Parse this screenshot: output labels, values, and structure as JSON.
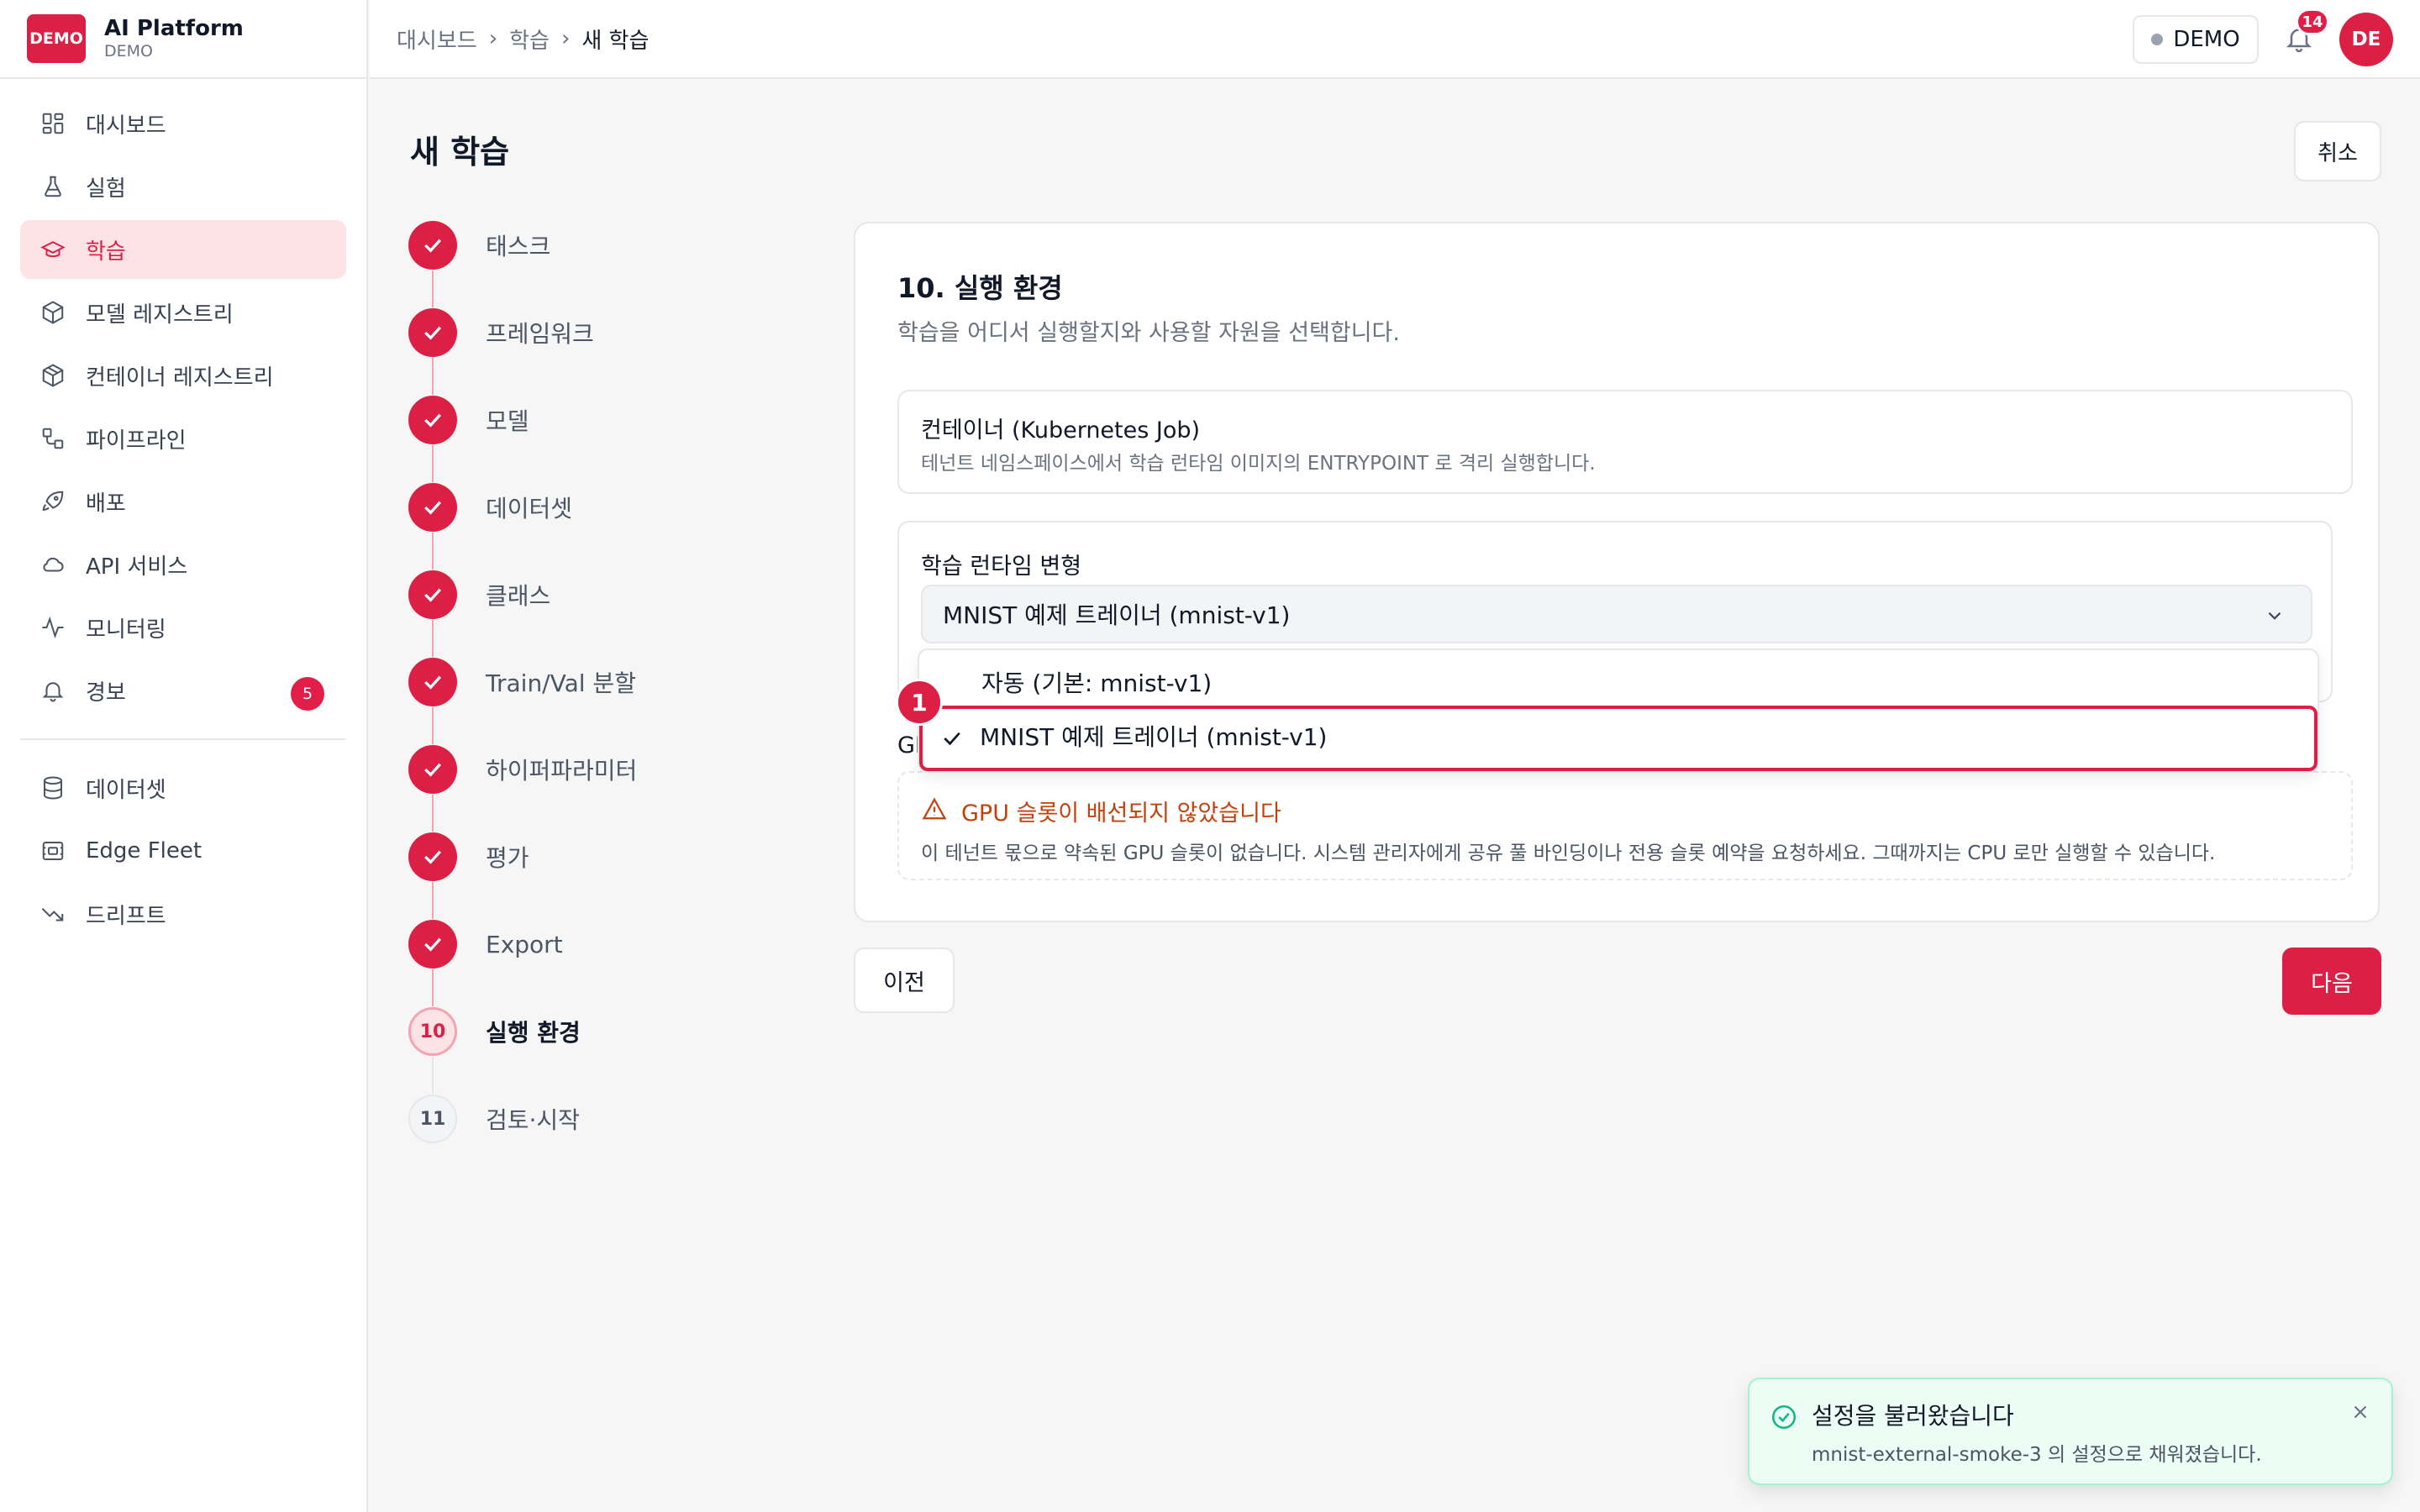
{
  "brand": {
    "logo_text": "DEMO",
    "name": "AI Platform",
    "sub": "DEMO"
  },
  "colors": {
    "accent": "#dc2045",
    "accent_soft": "#fde2e6",
    "warning": "#c2410c",
    "success": "#10b981"
  },
  "sidebar": {
    "items": [
      {
        "label": "대시보드",
        "icon": "dashboard-icon"
      },
      {
        "label": "실험",
        "icon": "flask-icon"
      },
      {
        "label": "학습",
        "icon": "graduation-cap-icon",
        "active": true
      },
      {
        "label": "모델 레지스트리",
        "icon": "cube-icon"
      },
      {
        "label": "컨테이너 레지스트리",
        "icon": "container-icon"
      },
      {
        "label": "파이프라인",
        "icon": "pipeline-icon"
      },
      {
        "label": "배포",
        "icon": "rocket-icon"
      },
      {
        "label": "API 서비스",
        "icon": "cloud-icon"
      },
      {
        "label": "모니터링",
        "icon": "activity-icon"
      },
      {
        "label": "경보",
        "icon": "bell-icon",
        "badge": "5"
      }
    ],
    "items2": [
      {
        "label": "데이터셋",
        "icon": "database-icon"
      },
      {
        "label": "Edge Fleet",
        "icon": "edge-device-icon"
      },
      {
        "label": "드리프트",
        "icon": "trending-down-icon"
      }
    ]
  },
  "topbar": {
    "breadcrumb": [
      "대시보드",
      "학습",
      "새 학습"
    ],
    "env": "DEMO",
    "notifications": "14",
    "avatar": "DE"
  },
  "page": {
    "title": "새 학습",
    "cancel": "취소"
  },
  "steps": [
    {
      "label": "태스크",
      "state": "done"
    },
    {
      "label": "프레임워크",
      "state": "done"
    },
    {
      "label": "모델",
      "state": "done"
    },
    {
      "label": "데이터셋",
      "state": "done"
    },
    {
      "label": "클래스",
      "state": "done"
    },
    {
      "label": "Train/Val 분할",
      "state": "done"
    },
    {
      "label": "하이퍼파라미터",
      "state": "done"
    },
    {
      "label": "평가",
      "state": "done"
    },
    {
      "label": "Export",
      "state": "done"
    },
    {
      "label": "실행 환경",
      "state": "current",
      "num": "10"
    },
    {
      "label": "검토·시작",
      "state": "todo",
      "num": "11"
    }
  ],
  "card": {
    "title": "10. 실행 환경",
    "desc": "학습을 어디서 실행할지와 사용할 자원을 선택합니다.",
    "option": {
      "title": "컨테이너 (Kubernetes Job)",
      "desc": "테넌트 네임스페이스에서 학습 런타임 이미지의 ENTRYPOINT 로 격리 실행합니다."
    },
    "variant_label": "학습 런타임 변형",
    "variant_value": "MNIST 예제 트레이너 (mnist-v1)",
    "gpu_label": "GI",
    "warning_title": "GPU 슬롯이 배선되지 않았습니다",
    "warning_desc": "이 테넌트 몫으로 약속된 GPU 슬롯이 없습니다. 시스템 관리자에게 공유 풀 바인딩이나 전용 슬롯 예약을 요청하세요. 그때까지는 CPU 로만 실행할 수 있습니다."
  },
  "dropdown": {
    "options": [
      "자동 (기본: mnist-v1)",
      "MNIST 예제 트레이너 (mnist-v1)"
    ],
    "selected_index": 1,
    "marker": "1"
  },
  "footer": {
    "prev": "이전",
    "next": "다음"
  },
  "toast": {
    "title": "설정을 불러왔습니다",
    "desc": "mnist-external-smoke-3 의 설정으로 채워졌습니다."
  }
}
